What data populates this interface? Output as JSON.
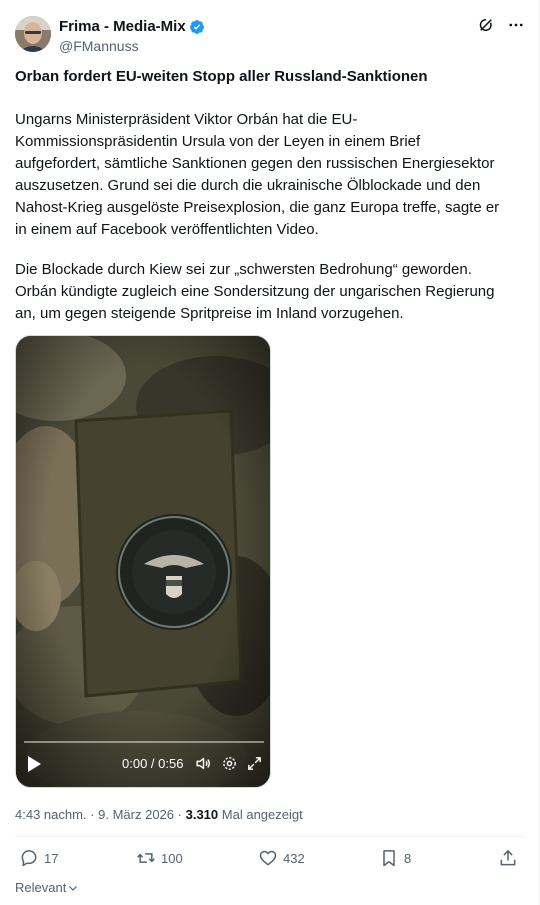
{
  "post": {
    "author": {
      "display_name": "Frima - Media-Mix",
      "handle": "@FMannuss",
      "verified": true
    },
    "headline": "Orban fordert EU-weiten Stopp aller Russland-Sanktionen",
    "paragraph_1": "Ungarns Ministerpräsident Viktor Orbán hat die EU-\nKommissionspräsidentin Ursula von der Leyen in einem Brief\naufgefordert, sämtliche Sanktionen gegen den russischen Energiesektor\nauszusetzen. Grund sei die durch die ukrainische Ölblockade und den\nNahost-Krieg ausgelöste Preisexplosion, die ganz Europa treffe, sagte er\nin einem auf Facebook veröffentlichten Video.",
    "paragraph_2": "Die Blockade durch Kiew sei zur „schwersten Bedrohung“ geworden.\nOrbán kündigte zugleich eine Sondersitzung der ungarischen Regierung\nan, um gegen steigende Spritpreise im Inland vorzugehen.",
    "video": {
      "time_display": "0:00 / 0:56",
      "progress": 0.0
    },
    "meta": {
      "time": "4:43 nachm.",
      "separator": "·",
      "date": "9. März 2026",
      "views": "3.310",
      "views_label": "Mal angezeigt"
    },
    "stats": {
      "replies": "17",
      "reposts": "100",
      "likes": "432",
      "bookmarks": "8"
    },
    "sort_label": "Relevant"
  },
  "icons": {
    "verified": "verified-badge-icon",
    "grok": "grok-icon",
    "more": "more-icon",
    "reply": "reply-icon",
    "repost": "repost-icon",
    "like": "like-icon",
    "bookmark": "bookmark-icon",
    "share": "share-icon",
    "play": "play-icon",
    "volume": "volume-icon",
    "settings": "settings-icon",
    "fullscreen": "fullscreen-icon",
    "chevron": "chevron-down-icon"
  },
  "colors": {
    "text": "#0f1419",
    "muted": "#536471",
    "verified": "#1d9bf0",
    "divider": "#eff3f4"
  }
}
